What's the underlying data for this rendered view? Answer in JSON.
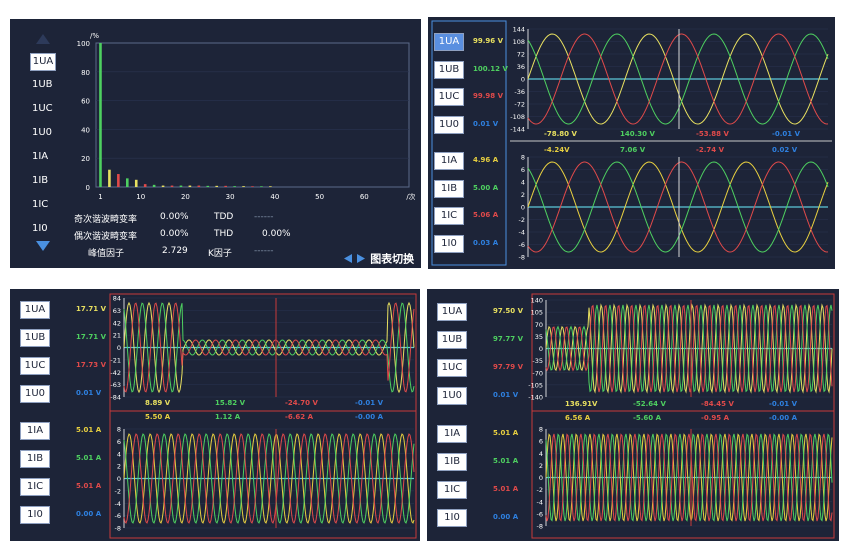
{
  "colors": {
    "a": "#e8e060",
    "b": "#4ed060",
    "c": "#e04a4a",
    "zero": "#2e80e0",
    "cur_a": "#e8d040",
    "bg": "#1d2438",
    "accent": "#4a90e0",
    "axis": "#5cc8d8"
  },
  "panel1": {
    "channels": [
      "1UA",
      "1UB",
      "1UC",
      "1U0",
      "1IA",
      "1IB",
      "1IC",
      "1I0"
    ],
    "selected": "1UA",
    "y_ticks": [
      "100",
      "80",
      "60",
      "40",
      "20",
      "0"
    ],
    "y_unit": "/%",
    "x_ticks": [
      "1",
      "10",
      "20",
      "30",
      "40",
      "50",
      "60"
    ],
    "x_unit": "/次",
    "stats": [
      {
        "label": "奇次谐波畸变率",
        "value": "0.00%",
        "label2": "TDD",
        "value2": "------"
      },
      {
        "label": "偶次谐波畸变率",
        "value": "0.00%",
        "label2": "THD",
        "value2": "0.00%"
      },
      {
        "label": "峰值因子",
        "value": "2.729",
        "label2": "K因子",
        "value2": "------"
      }
    ],
    "switch_label": "图表切换",
    "prev_icon": "left-triangle-icon",
    "next_icon": "right-triangle-icon",
    "up_icon": "up-triangle-icon",
    "down_icon": "down-triangle-icon",
    "chart_data": {
      "type": "bar",
      "x": [
        1,
        3,
        5,
        7,
        9,
        11,
        13,
        15,
        17,
        19,
        21,
        23,
        25,
        27,
        29,
        31,
        33,
        35,
        37,
        39
      ],
      "values": [
        100,
        12,
        9,
        6,
        5,
        2,
        1.5,
        1,
        1,
        1,
        1,
        1,
        0.8,
        0.8,
        0.8,
        0.6,
        0.6,
        0.5,
        0.5,
        0.5
      ],
      "ylim": [
        0,
        100
      ],
      "xlim": [
        0,
        70
      ],
      "xlabel": "/次",
      "ylabel": "/%"
    }
  },
  "panel2": {
    "u_channels": [
      {
        "name": "1UA",
        "value": "99.96 V"
      },
      {
        "name": "1UB",
        "value": "100.12 V"
      },
      {
        "name": "1UC",
        "value": "99.98 V"
      },
      {
        "name": "1U0",
        "value": "0.01 V"
      }
    ],
    "i_channels": [
      {
        "name": "1IA",
        "value": "4.96 A"
      },
      {
        "name": "1IB",
        "value": "5.00 A"
      },
      {
        "name": "1IC",
        "value": "5.06 A"
      },
      {
        "name": "1I0",
        "value": "0.03 A"
      }
    ],
    "u_ticks": [
      "144",
      "108",
      "72",
      "36",
      "0",
      "-36",
      "-72",
      "-108",
      "-144"
    ],
    "i_ticks": [
      "8",
      "6",
      "4",
      "2",
      "0",
      "-2",
      "-4",
      "-6",
      "-8"
    ],
    "u_cursor": [
      "-78.80 V",
      "140.30 V",
      "-53.88 V",
      "-0.01 V"
    ],
    "i_cursor": [
      "-4.24V",
      "7.06 V",
      "-2.74 V",
      "0.02 V"
    ],
    "selected": "1UA"
  },
  "panel3": {
    "u_channels": [
      {
        "name": "1UA",
        "value": "17.71 V"
      },
      {
        "name": "1UB",
        "value": "17.71 V"
      },
      {
        "name": "1UC",
        "value": "17.73 V"
      },
      {
        "name": "1U0",
        "value": "0.01 V"
      }
    ],
    "i_channels": [
      {
        "name": "1IA",
        "value": "5.01 A"
      },
      {
        "name": "1IB",
        "value": "5.01 A"
      },
      {
        "name": "1IC",
        "value": "5.01 A"
      },
      {
        "name": "1I0",
        "value": "0.00 A"
      }
    ],
    "u_ticks": [
      "84",
      "63",
      "42",
      "21",
      "0",
      "-21",
      "-42",
      "-63",
      "-84"
    ],
    "i_ticks": [
      "8",
      "6",
      "4",
      "2",
      "0",
      "-2",
      "-4",
      "-6",
      "-8"
    ],
    "u_cursor": [
      "8.89 V",
      "15.82 V",
      "-24.70 V",
      "-0.01 V"
    ],
    "i_cursor": [
      "5.50 A",
      "1.12 A",
      "-6.62 A",
      "-0.00 A"
    ]
  },
  "panel4": {
    "u_channels": [
      {
        "name": "1UA",
        "value": "97.50 V"
      },
      {
        "name": "1UB",
        "value": "97.77 V"
      },
      {
        "name": "1UC",
        "value": "97.79 V"
      },
      {
        "name": "1U0",
        "value": "0.01 V"
      }
    ],
    "i_channels": [
      {
        "name": "1IA",
        "value": "5.01 A"
      },
      {
        "name": "1IB",
        "value": "5.01 A"
      },
      {
        "name": "1IC",
        "value": "5.01 A"
      },
      {
        "name": "1I0",
        "value": "0.00 A"
      }
    ],
    "u_ticks": [
      "140",
      "105",
      "70",
      "35",
      "0",
      "-35",
      "-70",
      "-105",
      "-140"
    ],
    "i_ticks": [
      "8",
      "6",
      "4",
      "2",
      "0",
      "-2",
      "-4",
      "-6",
      "-8"
    ],
    "u_cursor": [
      "136.91V",
      "-52.64 V",
      "-84.45 V",
      "-0.01 V"
    ],
    "i_cursor": [
      "6.56 A",
      "-5.60 A",
      "-0.95 A",
      "-0.00 A"
    ]
  }
}
